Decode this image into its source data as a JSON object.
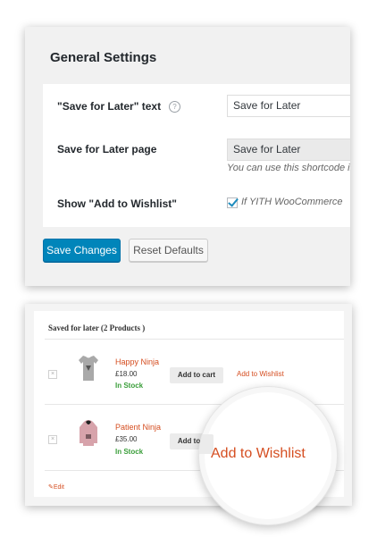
{
  "settings": {
    "title": "General Settings",
    "rows": [
      {
        "label": "\"Save for Later\" text",
        "value": "Save for Later"
      },
      {
        "label": "Save for Later page",
        "value": "Save for Later",
        "description": "You can use this shortcode in"
      },
      {
        "label": "Show \"Add to Wishlist\"",
        "checked": true,
        "description": "If YITH WooCommerce"
      }
    ],
    "help_glyph": "?",
    "save_label": "Save Changes",
    "reset_label": "Reset Defaults",
    "colors": {
      "primary_button": "#0085ba",
      "checkbox_mark": "#1e8cbe"
    }
  },
  "saved_list": {
    "title": "Saved for later (2 Products )",
    "remove_glyph": "×",
    "products": [
      {
        "name": "Happy Ninja",
        "price": "£18.00",
        "stock": "In Stock",
        "cart_label": "Add to cart",
        "wishlist_label": "Add to Wishlist",
        "image_icon": "grey-tshirt-icon"
      },
      {
        "name": "Patient Ninja",
        "price": "£35.00",
        "stock": "In Stock",
        "cart_label": "Add to cart",
        "image_icon": "pink-hoodie-icon"
      }
    ],
    "edit_label": "Edit",
    "edit_icon": "pencil-icon",
    "colors": {
      "link": "#d54e21",
      "in_stock": "#3a9e3a"
    }
  },
  "magnifier": {
    "text": "Add to Wishlist"
  }
}
